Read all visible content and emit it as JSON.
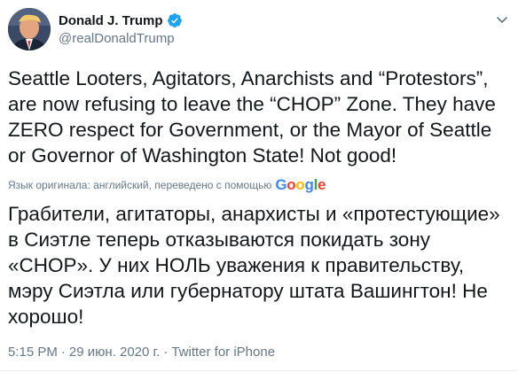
{
  "author": {
    "name": "Donald J. Trump",
    "handle": "@realDonaldTrump"
  },
  "tweet": {
    "text": "Seattle Looters, Agitators, Anarchists and “Protestors”, are now refusing to leave the “CHOP” Zone. They have ZERO respect for Government, or the Mayor of Seattle or Governor of Washington State! Not good!",
    "translation_label": "Язык оригинала: английский, переведено с помощью",
    "translation_provider": {
      "letters": [
        "G",
        "o",
        "o",
        "g",
        "l",
        "e"
      ],
      "alt": "Google"
    },
    "translated_text": "Грабители, агитаторы, анархисты и «протестующие» в Сиэтле теперь отказываются покидать зону «CHOP». У них НОЛЬ уважения к правительству, мэру Сиэтла или губернатору штата Вашингтон! Не хорошо!"
  },
  "meta": {
    "time": "5:15 PM",
    "separator": "·",
    "date": "29 июн. 2020 г.",
    "source": "Twitter for iPhone"
  },
  "icons": {
    "verified": "verified-badge-icon",
    "menu": "chevron-down-icon"
  },
  "colors": {
    "verified": "#1da1f2",
    "secondary_text": "#657786",
    "primary_text": "#14171a"
  }
}
